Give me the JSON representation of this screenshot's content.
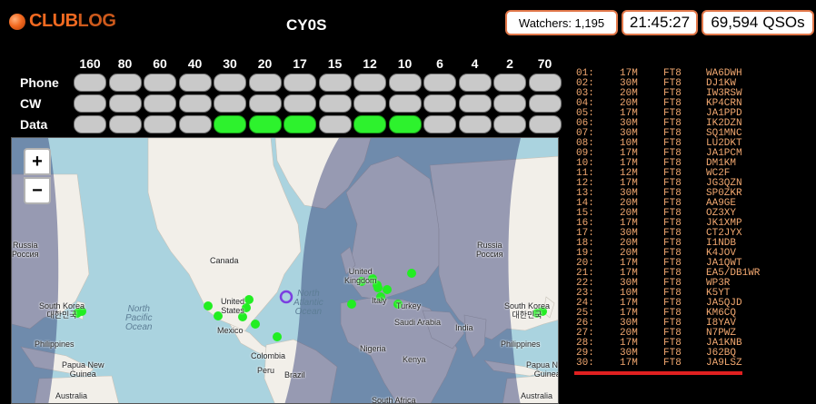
{
  "app": {
    "logo_text_club": "CLUB",
    "logo_text_log": "LOG",
    "callsign": "CY0S"
  },
  "header": {
    "watchers": "Watchers: 1,195",
    "clock": "21:45:27",
    "qso_count": "69,594",
    "qso_label": "QSOs"
  },
  "bands": {
    "labels": [
      "160",
      "80",
      "60",
      "40",
      "30",
      "20",
      "17",
      "15",
      "12",
      "10",
      "6",
      "4",
      "2",
      "70"
    ],
    "rows": [
      {
        "label": "Phone",
        "active": [
          false,
          false,
          false,
          false,
          false,
          false,
          false,
          false,
          false,
          false,
          false,
          false,
          false,
          false
        ]
      },
      {
        "label": "CW",
        "active": [
          false,
          false,
          false,
          false,
          false,
          false,
          false,
          false,
          false,
          false,
          false,
          false,
          false,
          false
        ]
      },
      {
        "label": "Data",
        "active": [
          false,
          false,
          false,
          false,
          true,
          true,
          true,
          false,
          true,
          true,
          false,
          false,
          false,
          false
        ]
      }
    ]
  },
  "map": {
    "zoom_in": "+",
    "zoom_out": "−",
    "labels": {
      "russia_w": "Russia\nРоссия",
      "russia_e": "Russia\nРоссия",
      "canada": "Canada",
      "united_states": "United\nStates",
      "mexico": "Mexico",
      "colombia": "Colombia",
      "peru": "Peru",
      "brazil": "Brazil",
      "south_korea_w": "South Korea\n대한민국",
      "south_korea_e": "South Korea\n대한민국",
      "philippines_w": "Philippines",
      "philippines_e": "Philippines",
      "png_w": "Papua New\nGuinea",
      "png_e": "Papua New\nGuinea",
      "australia_w": "Australia",
      "australia_e": "Australia",
      "united_kingdom": "United\nKingdom",
      "italy": "Italy",
      "turkey": "Turkey",
      "saudi_arabia": "Saudi Arabia",
      "india": "India",
      "nigeria": "Nigeria",
      "kenya": "Kenya",
      "south_africa": "South Africa",
      "north_pacific": "North\nPacific\nOcean",
      "north_atlantic": "North\nAtlantic\nOcean"
    },
    "colors": {
      "spot": "#22ee22",
      "dxcc": "#7b3fe0",
      "ocean": "#aad3df",
      "land": "#f2efe9",
      "night": "rgba(40,50,110,0.45)"
    }
  },
  "spots": [
    {
      "n": "01:",
      "band": "17M",
      "mode": "FT8",
      "call": "WA6DWH"
    },
    {
      "n": "02:",
      "band": "30M",
      "mode": "FT8",
      "call": "DJ1KW"
    },
    {
      "n": "03:",
      "band": "20M",
      "mode": "FT8",
      "call": "IW3RSW"
    },
    {
      "n": "04:",
      "band": "20M",
      "mode": "FT8",
      "call": "KP4CRN"
    },
    {
      "n": "05:",
      "band": "17M",
      "mode": "FT8",
      "call": "JA1PPD"
    },
    {
      "n": "06:",
      "band": "30M",
      "mode": "FT8",
      "call": "IK2DZN"
    },
    {
      "n": "07:",
      "band": "30M",
      "mode": "FT8",
      "call": "SQ1MNC"
    },
    {
      "n": "08:",
      "band": "10M",
      "mode": "FT8",
      "call": "LU2DKT"
    },
    {
      "n": "09:",
      "band": "17M",
      "mode": "FT8",
      "call": "JA1PCM"
    },
    {
      "n": "10:",
      "band": "17M",
      "mode": "FT8",
      "call": "DM1KM"
    },
    {
      "n": "11:",
      "band": "12M",
      "mode": "FT8",
      "call": "WC2F"
    },
    {
      "n": "12:",
      "band": "17M",
      "mode": "FT8",
      "call": "JG3QZN"
    },
    {
      "n": "13:",
      "band": "30M",
      "mode": "FT8",
      "call": "SP0ZKR"
    },
    {
      "n": "14:",
      "band": "20M",
      "mode": "FT8",
      "call": "AA9GE"
    },
    {
      "n": "15:",
      "band": "20M",
      "mode": "FT8",
      "call": "OZ3XY"
    },
    {
      "n": "16:",
      "band": "17M",
      "mode": "FT8",
      "call": "JK1XMP"
    },
    {
      "n": "17:",
      "band": "30M",
      "mode": "FT8",
      "call": "CT2JYX"
    },
    {
      "n": "18:",
      "band": "20M",
      "mode": "FT8",
      "call": "I1NDB"
    },
    {
      "n": "19:",
      "band": "20M",
      "mode": "FT8",
      "call": "K4JOV"
    },
    {
      "n": "20:",
      "band": "17M",
      "mode": "FT8",
      "call": "JA1QWT"
    },
    {
      "n": "21:",
      "band": "17M",
      "mode": "FT8",
      "call": "EA5/DB1WR"
    },
    {
      "n": "22:",
      "band": "30M",
      "mode": "FT8",
      "call": "WP3R"
    },
    {
      "n": "23:",
      "band": "10M",
      "mode": "FT8",
      "call": "K5YT"
    },
    {
      "n": "24:",
      "band": "17M",
      "mode": "FT8",
      "call": "JA5QJD"
    },
    {
      "n": "25:",
      "band": "17M",
      "mode": "FT8",
      "call": "KM6CQ"
    },
    {
      "n": "26:",
      "band": "30M",
      "mode": "FT8",
      "call": "I8YAV"
    },
    {
      "n": "27:",
      "band": "20M",
      "mode": "FT8",
      "call": "N7PWZ"
    },
    {
      "n": "28:",
      "band": "17M",
      "mode": "FT8",
      "call": "JA1KNB"
    },
    {
      "n": "29:",
      "band": "30M",
      "mode": "FT8",
      "call": "J62BQ"
    },
    {
      "n": "30:",
      "band": "17M",
      "mode": "FT8",
      "call": "JA9LSZ"
    }
  ]
}
